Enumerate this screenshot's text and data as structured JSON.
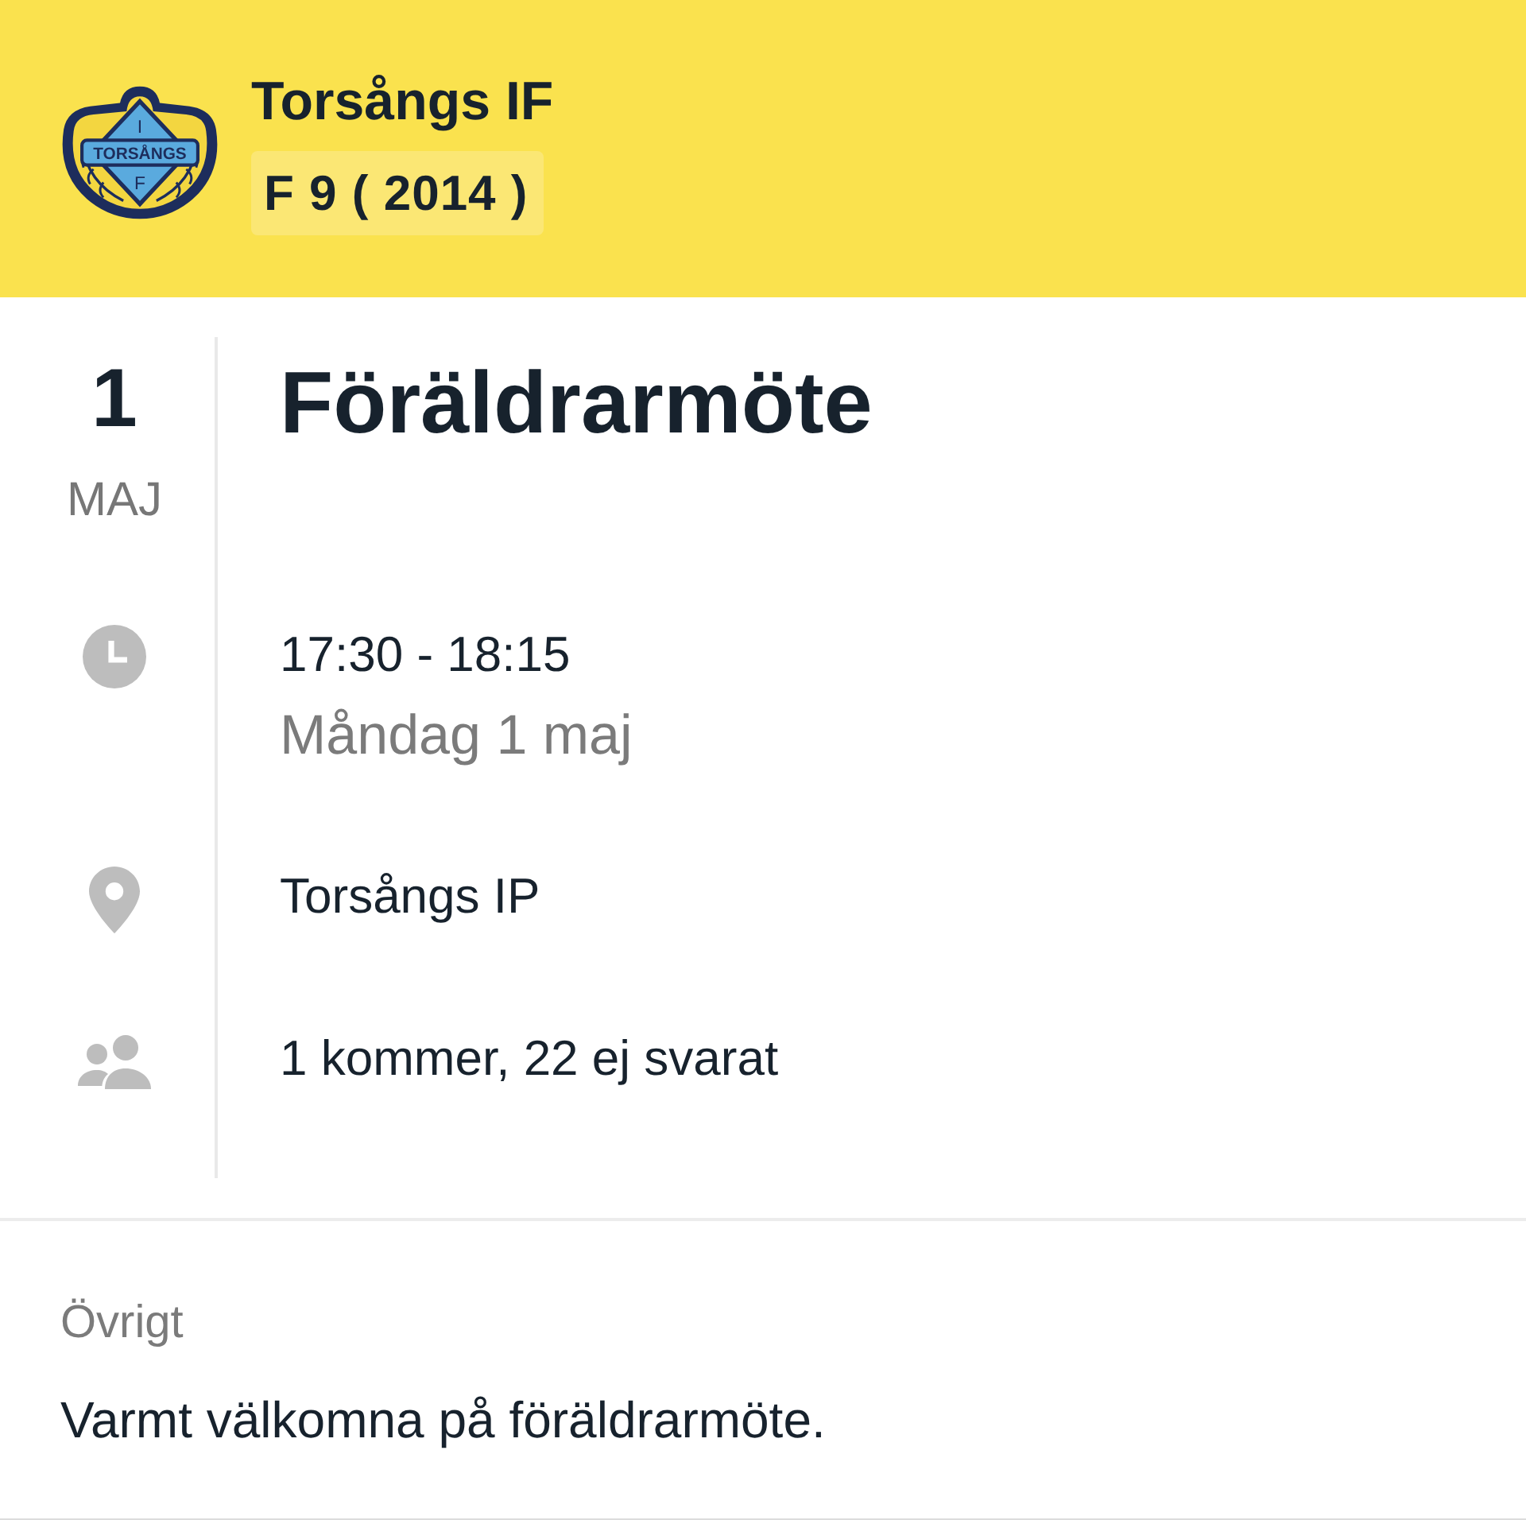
{
  "header": {
    "logo": {
      "top_letter": "I",
      "band_text": "TORSÅNGS",
      "bottom_letter": "F"
    },
    "team_name": "Torsångs IF",
    "team_tag": "F 9 ( 2014 )"
  },
  "event": {
    "day": "1",
    "month": "MAJ",
    "title": "Föräldrarmöte",
    "details": [
      {
        "kind": "time",
        "text": "17:30 - 18:15",
        "subtext": "Måndag 1 maj"
      },
      {
        "kind": "location",
        "text": "Torsångs IP"
      },
      {
        "kind": "attendance",
        "text": "1 kommer, 22 ej svarat"
      }
    ]
  },
  "notes": {
    "heading": "Övrigt",
    "text": "Varmt välkomna på föräldrarmöte."
  }
}
